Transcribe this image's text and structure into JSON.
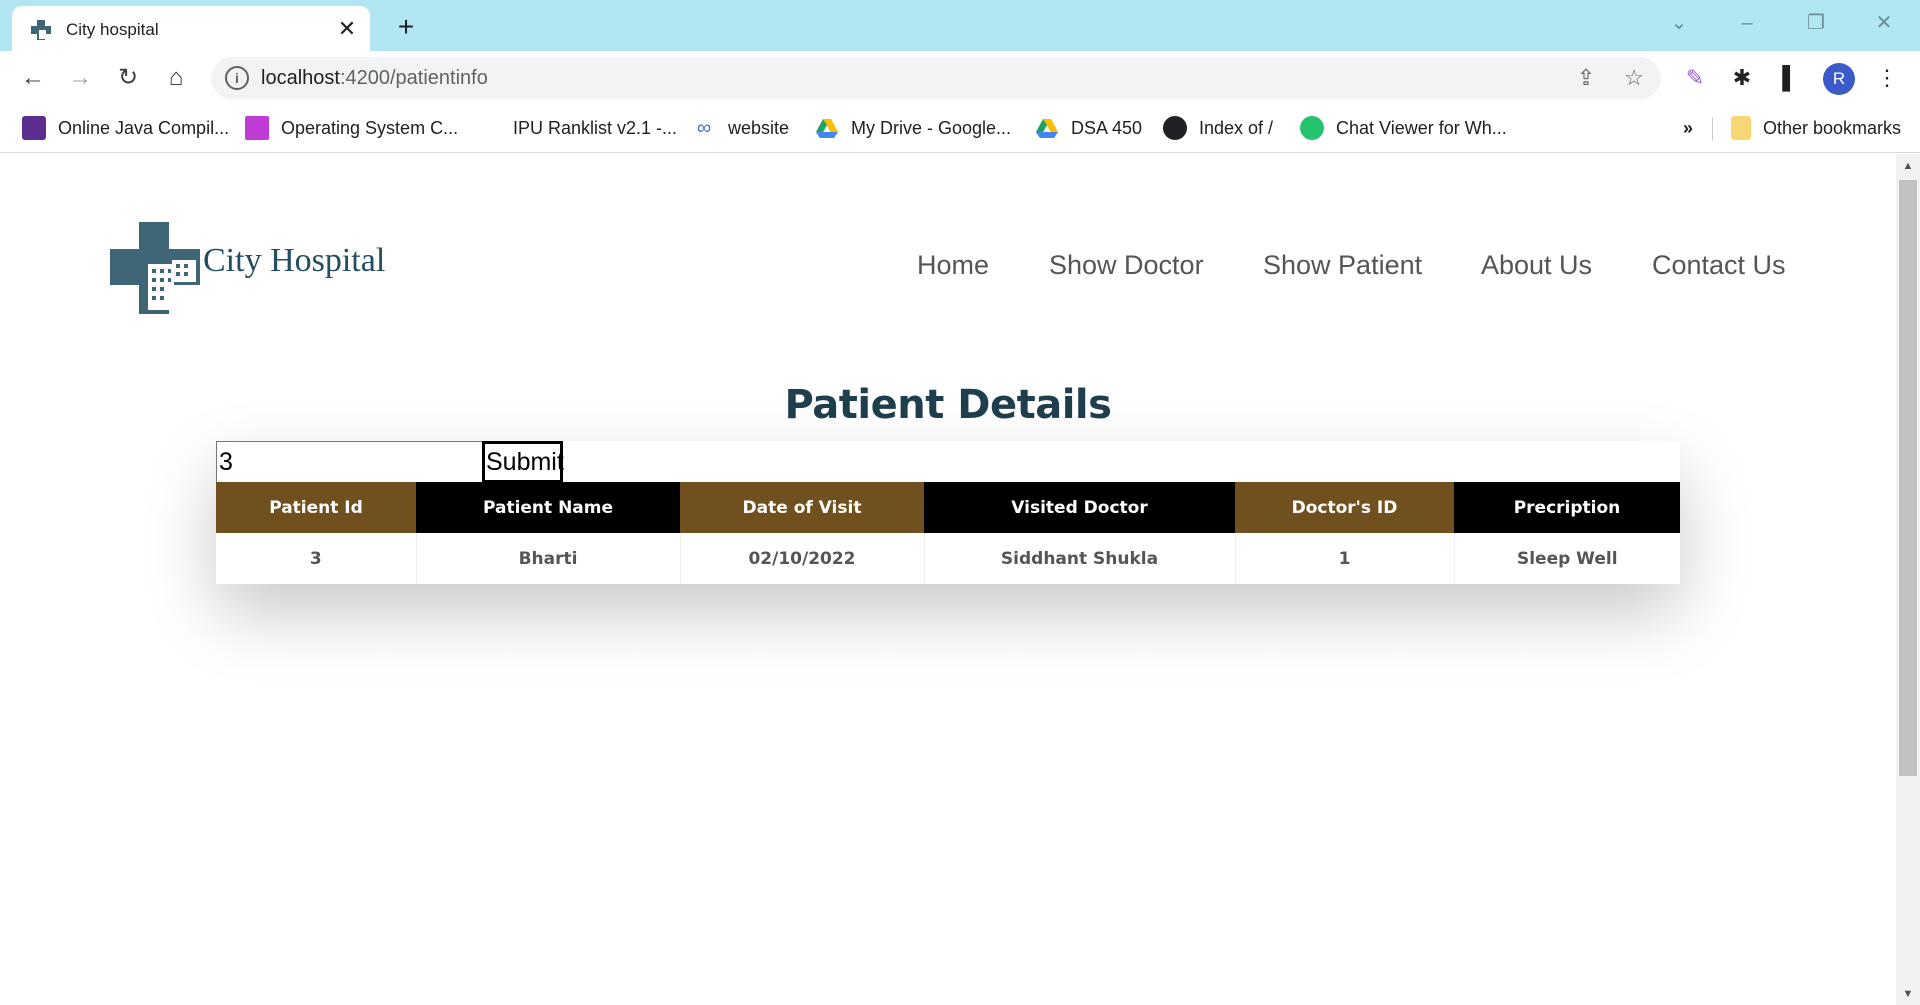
{
  "browser": {
    "tab_title": "City hospital",
    "url_host": "localhost",
    "url_path": ":4200/patientinfo",
    "avatar_letter": "R",
    "bookmarks": [
      {
        "label": "Online Java Compil...",
        "icon": "java-compiler-icon",
        "color": "#5b2d8e"
      },
      {
        "label": "Operating System C...",
        "icon": "os-course-icon",
        "color": "#c03ad6"
      },
      {
        "label": "IPU Ranklist v2.1 -...",
        "icon": "blank-page-icon",
        "color": "#ffffff"
      },
      {
        "label": "website",
        "icon": "infinity-icon",
        "color": "#3a6fd8"
      },
      {
        "label": "My Drive - Google...",
        "icon": "google-drive-icon",
        "color": "#1fa463"
      },
      {
        "label": "DSA 450",
        "icon": "google-drive-icon",
        "color": "#1fa463"
      },
      {
        "label": "Index of /",
        "icon": "globe-icon",
        "color": "#202124"
      },
      {
        "label": "Chat Viewer for Wh...",
        "icon": "chat-icon",
        "color": "#25c26e"
      }
    ],
    "overflow_label": "»",
    "other_bookmarks": "Other bookmarks"
  },
  "site": {
    "logo_text": "City Hospital",
    "nav": [
      "Home",
      "Show Doctor",
      "Show Patient",
      "About Us",
      "Contact Us"
    ],
    "heading": "Patient Details",
    "search_value": "3",
    "submit_label": "Submit",
    "brand_colors": {
      "brown": "#71501f",
      "black": "#000000",
      "logo": "#3f6677"
    }
  },
  "table": {
    "headers": [
      "Patient Id",
      "Patient Name",
      "Date of Visit",
      "Visited Doctor",
      "Doctor's ID",
      "Precription"
    ],
    "rows": [
      [
        "3",
        "Bharti",
        "02/10/2022",
        "Siddhant Shukla",
        "1",
        "Sleep Well"
      ]
    ]
  }
}
